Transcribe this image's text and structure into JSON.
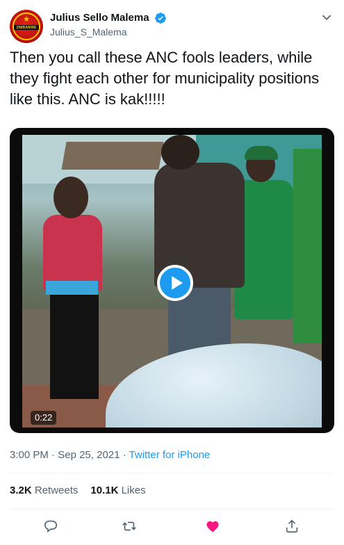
{
  "author": {
    "display_name": "Julius Sello Malema",
    "handle": "Julius_S_Malema",
    "avatar_logo_text": "ZIMBABWE"
  },
  "tweet": {
    "text": "Then you call these ANC fools leaders, while they fight each other for municipality positions like this. ANC is kak!!!!!"
  },
  "video": {
    "duration": "0:22"
  },
  "meta": {
    "time": "3:00 PM",
    "separator1": " · ",
    "date": "Sep 25, 2021",
    "separator2": " · ",
    "source": "Twitter for iPhone"
  },
  "stats": {
    "retweets_count": "3.2K",
    "retweets_label": "Retweets",
    "likes_count": "10.1K",
    "likes_label": "Likes"
  },
  "colors": {
    "accent": "#1d9bf0",
    "like_active": "#f91880",
    "secondary_text": "#536471",
    "icon_gray": "#536471"
  },
  "icons": [
    "verified-badge-icon",
    "chevron-down-icon",
    "play-icon",
    "reply-icon",
    "retweet-icon",
    "like-icon",
    "share-icon"
  ]
}
